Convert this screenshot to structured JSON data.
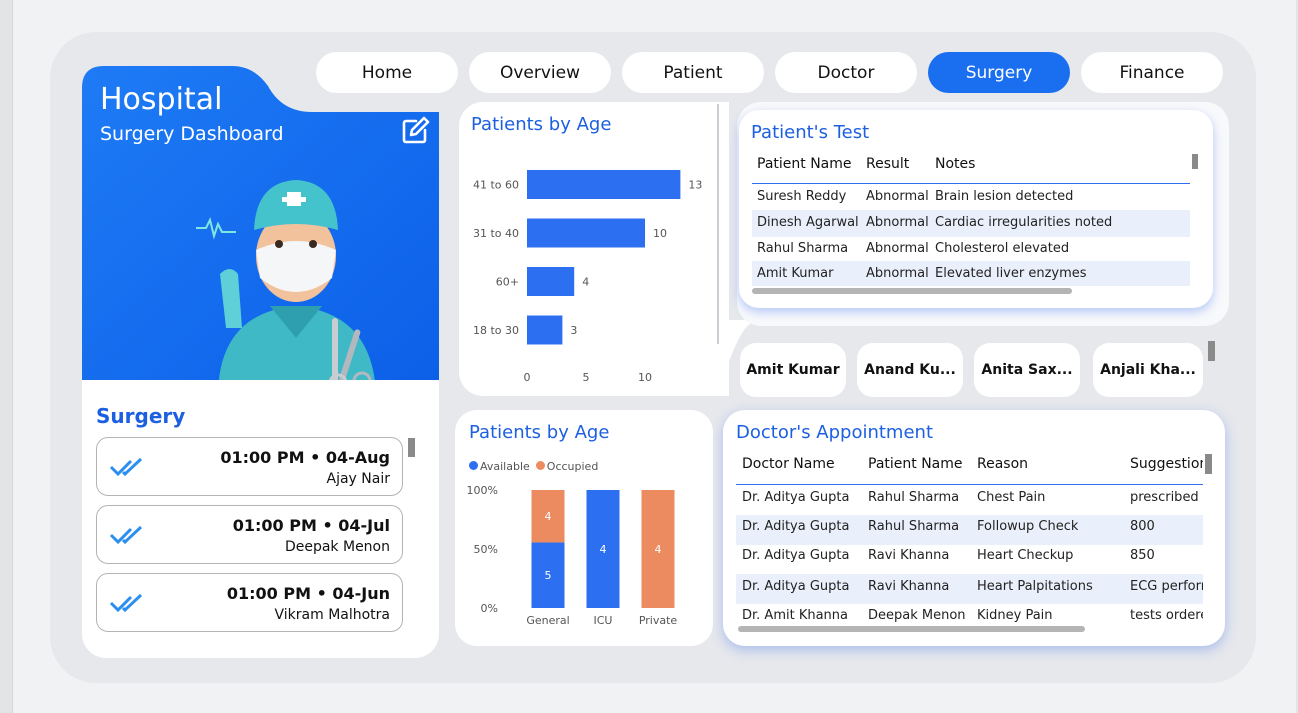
{
  "nav": {
    "tabs": [
      "Home",
      "Overview",
      "Patient",
      "Doctor",
      "Surgery",
      "Finance"
    ],
    "active": "Surgery"
  },
  "hero": {
    "title": "Hospital",
    "subtitle": "Surgery Dashboard",
    "edit_icon": "edit-icon",
    "illustration": "surgeon-illustration"
  },
  "surgery": {
    "title": "Surgery",
    "items": [
      {
        "time": "01:00 PM • 04-Aug",
        "name": "Ajay Nair"
      },
      {
        "time": "01:00 PM • 04-Jul",
        "name": "Deepak Menon"
      },
      {
        "time": "01:00 PM • 04-Jun",
        "name": "Vikram Malhotra"
      }
    ]
  },
  "patients_by_age_chart": {
    "title": "Patients by Age",
    "chart_data": {
      "type": "bar",
      "orientation": "horizontal",
      "categories": [
        "41 to 60",
        "31 to 40",
        "60+",
        "18 to 30"
      ],
      "values": [
        13,
        10,
        4,
        3
      ],
      "xticks": [
        "0",
        "5",
        "10"
      ],
      "xlim": [
        0,
        13
      ],
      "color": "#2c6ff0"
    }
  },
  "beds_chart": {
    "title": "Patients by Age",
    "legend": [
      "Available",
      "Occupied"
    ],
    "chart_data": {
      "type": "bar",
      "stacked": "percent",
      "categories": [
        "General",
        "ICU",
        "Private"
      ],
      "series": [
        {
          "name": "Available",
          "values": [
            5,
            4,
            0
          ],
          "color": "#2c6ff0"
        },
        {
          "name": "Occupied",
          "values": [
            4,
            0,
            4
          ],
          "color": "#ec8b60"
        }
      ],
      "yticks": [
        "100%",
        "50%",
        "0%"
      ]
    }
  },
  "patients_test": {
    "title": "Patient's Test",
    "columns": [
      "Patient Name",
      "Result",
      "Notes"
    ],
    "rows": [
      [
        "Suresh Reddy",
        "Abnormal",
        "Brain lesion detected"
      ],
      [
        "Dinesh Agarwal",
        "Abnormal",
        "Cardiac irregularities noted"
      ],
      [
        "Rahul Sharma",
        "Abnormal",
        "Cholesterol elevated"
      ],
      [
        "Amit Kumar",
        "Abnormal",
        "Elevated liver enzymes"
      ]
    ]
  },
  "patient_chips": [
    "Amit Kumar",
    "Anand Ku...",
    "Anita Sax...",
    "Anjali Kha..."
  ],
  "appointments": {
    "title": "Doctor's Appointment",
    "columns": [
      "Doctor Name",
      "Patient Name",
      "Reason",
      "Suggestion"
    ],
    "rows": [
      [
        "Dr. Aditya Gupta",
        "Rahul Sharma",
        "Chest Pain",
        "prescribed m"
      ],
      [
        "Dr. Aditya Gupta",
        "Rahul Sharma",
        "Followup Check",
        "800"
      ],
      [
        "Dr. Aditya Gupta",
        "Ravi Khanna",
        "Heart Checkup",
        "850"
      ],
      [
        "Dr. Aditya Gupta",
        "Ravi Khanna",
        "Heart Palpitations",
        "ECG perform"
      ],
      [
        "Dr. Amit Khanna",
        "Deepak Menon",
        "Kidney Pain",
        "tests orderec"
      ]
    ]
  },
  "colors": {
    "accent": "#1a6ef0",
    "title": "#1c5fe0",
    "bar": "#2c6ff0",
    "occupied": "#ec8b60"
  }
}
